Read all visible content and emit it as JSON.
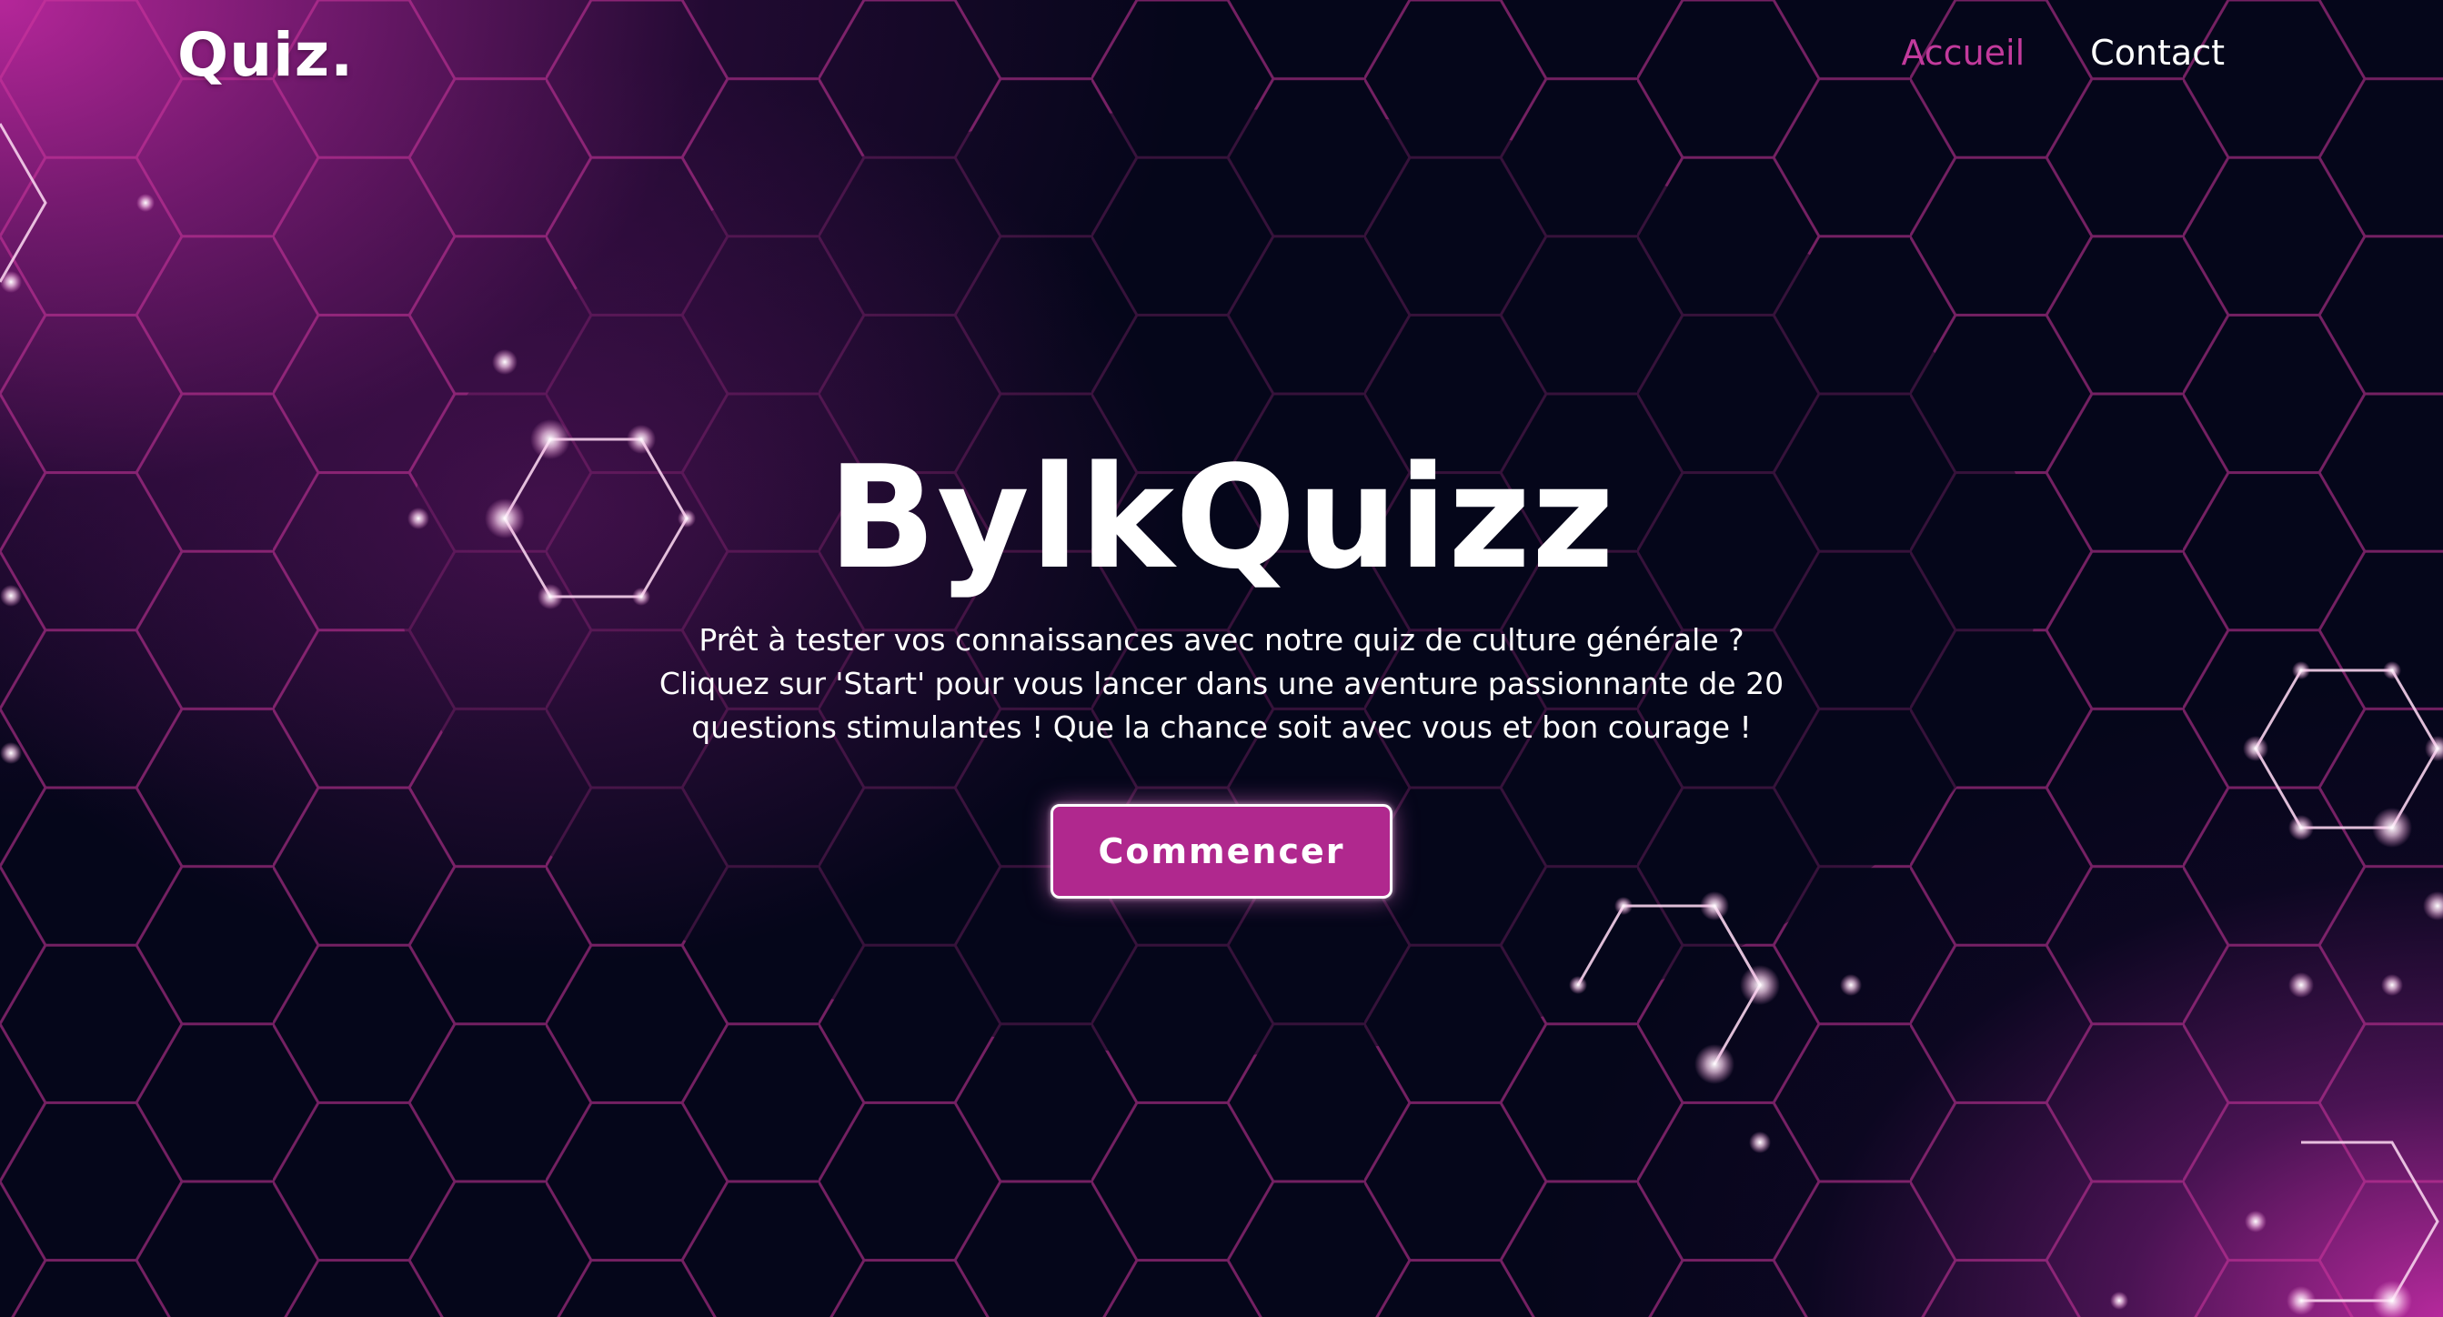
{
  "header": {
    "brand": "Quiz.",
    "nav": [
      {
        "label": "Accueil",
        "active": true
      },
      {
        "label": "Contact",
        "active": false
      }
    ]
  },
  "hero": {
    "title": "BylkQuizz",
    "description": "Prêt à tester vos connaissances avec notre quiz de culture générale ? Cliquez sur 'Start' pour vous lancer dans une aventure passionnante de 20 questions stimulantes ! Que la chance soit avec vous et bon courage !",
    "button_label": "Commencer"
  },
  "colors": {
    "accent": "#c23a9c",
    "button": "#b0288e",
    "background": "#05061a"
  }
}
